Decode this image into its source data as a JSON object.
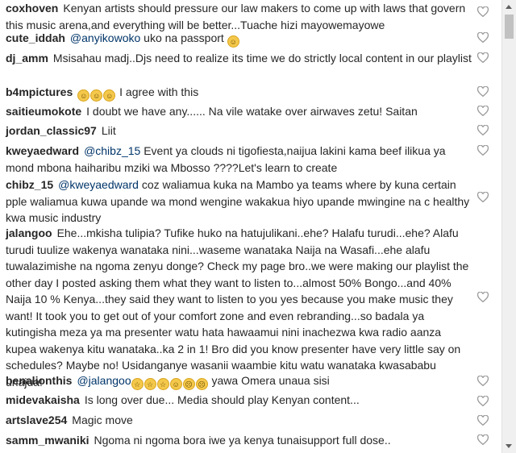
{
  "comments": [
    {
      "user": "coxhoven",
      "mention": "",
      "emoji": [],
      "text": "Kenyan artists should pressure our law makers to come up with laws that govern this music arena,and everything will be better...Tuache hizi mayowemayowe"
    },
    {
      "user": "cute_iddah",
      "mention": "@anyikowoko",
      "emoji": [],
      "text": " uko na passport ",
      "emoji_after": [
        "rofl"
      ]
    },
    {
      "user": "dj_amm",
      "mention": "",
      "emoji": [],
      "text": "Msisahau madj..Djs need to realize its time we do strictly local content in our playlist"
    },
    {
      "user": "b4mpictures",
      "mention": "",
      "emoji": [
        "grin",
        "grin",
        "grin"
      ],
      "text": " I agree with this"
    },
    {
      "user": "saitieumokote",
      "mention": "",
      "emoji": [],
      "text": "I doubt we have any...... Na vile watake over airwaves zetu! Saitan"
    },
    {
      "user": "jordan_classic97",
      "mention": "",
      "emoji": [],
      "text": "Liit"
    },
    {
      "user": "kweyaedward",
      "mention": "@chibz_15",
      "emoji": [],
      "text": " Event ya clouds ni tigofiesta,naijua lakini kama beef ilikua ya mond mbona haiharibu mziki wa Mbosso ????Let's learn to create"
    },
    {
      "user": "chibz_15",
      "mention": "@kweyaedward",
      "emoji": [],
      "text": " coz waliamua kuka na Mambo ya teams where by kuna certain pple waliamua kuwa upande wa mond wengine wakakua hiyo upande mwingine na c healthy kwa music industry"
    },
    {
      "user": "jalangoo",
      "mention": "",
      "emoji": [],
      "text": "Ehe...mkisha tulipia? Tufike huko na hatujulikani..ehe? Halafu turudi...ehe? Alafu turudi tuulize wakenya wanataka nini...waseme wanataka Naija na Wasafi...ehe alafu tuwalazimishe na ngoma zenyu donge? Check my page bro..we were making our playlist the other day I posted asking them what they want to listen to...almost 50% Bongo...and 40% Naija 10 % Kenya...they said they want to listen to you yes because you make music they want! It took you to get out of your comfort zone and even rebranding...so badala ya kutingisha meza ya ma presenter watu hata hawaamui nini inachezwa kwa radio aanza kupea wakenya kitu wanataka..ka 2 in 1! Bro did you know presenter have very little say on schedules? Maybe no! Usidanganye wasanii waambie kitu watu wanataka kwasababu unajua!"
    },
    {
      "user": "benalionthis",
      "mention": "@jalangoo",
      "emoji": [
        "scream",
        "scream",
        "scream",
        "grin",
        "tired",
        "tired"
      ],
      "text": " yawa Omera unaua sisi"
    },
    {
      "user": "midevakaisha",
      "mention": "",
      "emoji": [],
      "text": "Is long over due... Media should play Kenyan content..."
    },
    {
      "user": "artslave254",
      "mention": "",
      "emoji": [],
      "text": "Magic move"
    },
    {
      "user": "samm_mwaniki",
      "mention": "",
      "emoji": [],
      "text": "Ngoma ni ngoma bora iwe ya kenya tunaisupport full dose.."
    }
  ],
  "colors": {
    "text": "#262626",
    "mention": "#003569",
    "heart": "#999999"
  },
  "icons": {
    "like": "heart-outline-icon"
  }
}
